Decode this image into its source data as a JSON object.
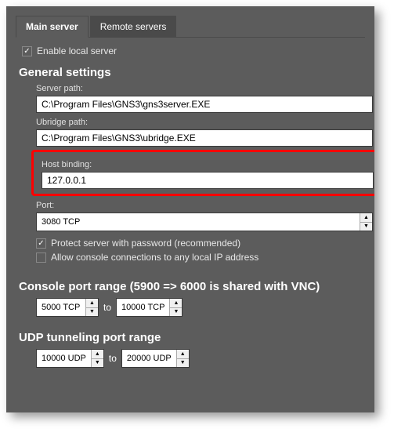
{
  "tabs": {
    "main": "Main server",
    "remote": "Remote servers"
  },
  "enableLocal": "Enable local server",
  "general": {
    "title": "General settings",
    "serverPathLabel": "Server path:",
    "serverPath": "C:\\Program Files\\GNS3\\gns3server.EXE",
    "ubridgePathLabel": "Ubridge path:",
    "ubridgePath": "C:\\Program Files\\GNS3\\ubridge.EXE",
    "hostBindingLabel": "Host binding:",
    "hostBinding": "127.0.0.1",
    "portLabel": "Port:",
    "port": "3080 TCP",
    "protect": "Protect server with password (recommended)",
    "allowConsole": "Allow console connections to any local IP address"
  },
  "consoleRange": {
    "title": "Console port range (5900 => 6000 is shared with VNC)",
    "from": "5000 TCP",
    "to": "10000 TCP",
    "toLabel": "to"
  },
  "udpRange": {
    "title": "UDP tunneling port range",
    "from": "10000 UDP",
    "to": "20000 UDP",
    "toLabel": "to"
  }
}
